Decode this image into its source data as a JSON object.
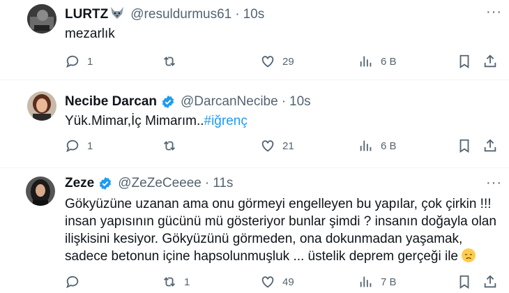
{
  "tweets": [
    {
      "name": "LURTZ",
      "name_suffix_icon": "wolf-face-emoji",
      "handle": "@resuldurmus61",
      "sep": "·",
      "time": "10s",
      "text_plain": "mezarlık",
      "verified": false,
      "actions": {
        "reply": "1",
        "retweet": "",
        "like": "29",
        "views": "6 B"
      }
    },
    {
      "name": "Necibe Darcan",
      "handle": "@DarcanNecibe",
      "sep": "·",
      "time": "10s",
      "text_plain": "Yük.Mimar,İç Mimarım..",
      "hashtag": "#iğrenç",
      "verified": true,
      "actions": {
        "reply": "1",
        "retweet": "",
        "like": "21",
        "views": "6 B"
      }
    },
    {
      "name": "Zeze",
      "handle": "@ZeZeCeeee",
      "sep": "·",
      "time": "11s",
      "text_lines": [
        "Gökyüzüne uzanan ama onu görmeyi engelleyen bu yapılar, çok çirkin !!!",
        "insan yapısının gücünü mü gösteriyor bunlar şimdi ? insanın doğayla olan",
        "ilişkisini kesiyor. Gökyüzünü görmeden, ona dokunmadan yaşamak,",
        "sadece betonun içine hapsolunmuşluk ... üstelik deprem gerçeği ile"
      ],
      "end_emoji": "disappointed-face-emoji",
      "verified": true,
      "actions": {
        "reply": "",
        "retweet": "1",
        "like": "49",
        "views": "7 B"
      }
    }
  ],
  "colors": {
    "verified": "#1d9bf0",
    "hashtag": "#1d9bf0",
    "secondary": "#536471"
  }
}
